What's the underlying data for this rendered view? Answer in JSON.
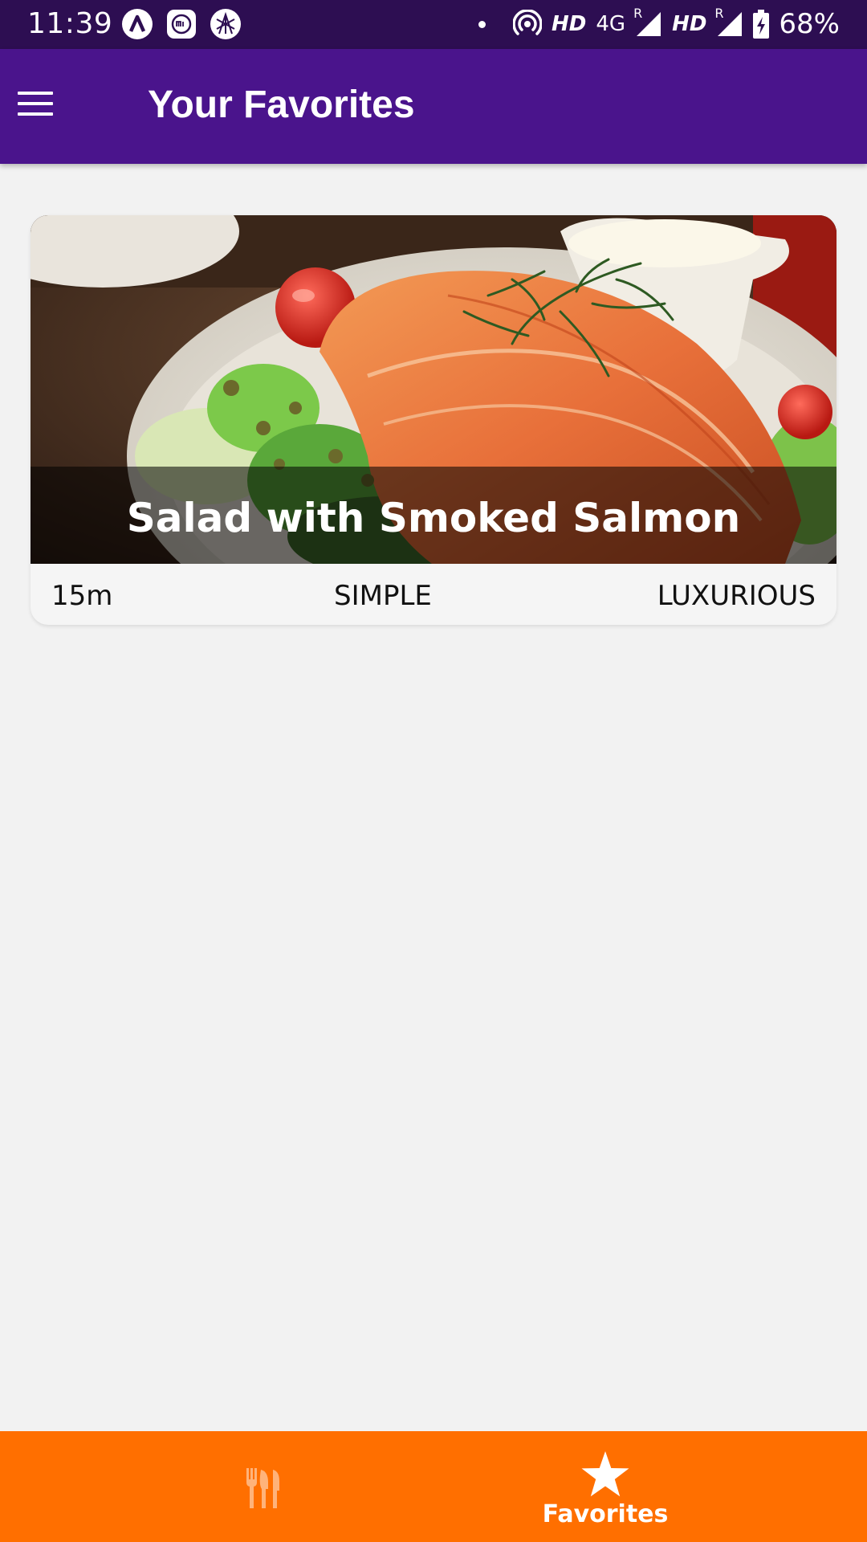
{
  "status_bar": {
    "time": "11:39",
    "network_1": "4G",
    "hd_1": "HD",
    "roaming_1": "R",
    "hd_2": "HD",
    "roaming_2": "R",
    "battery": "68%",
    "icons": [
      "notification-app-icon",
      "mi-app-icon",
      "spider-app-icon",
      "hotspot-icon",
      "signal-icon",
      "battery-charging-icon"
    ]
  },
  "app_bar": {
    "title": "Your Favorites",
    "menu_icon": "hamburger-menu-icon"
  },
  "meals": [
    {
      "title": "Salad with Smoked Salmon",
      "duration": "15m",
      "complexity": "SIMPLE",
      "affordability": "LUXURIOUS",
      "image": "smoked-salmon-salad-photo"
    }
  ],
  "tabs": [
    {
      "label": "Meals",
      "icon": "restaurant-icon",
      "active": false
    },
    {
      "label": "Favorites",
      "icon": "star-icon",
      "active": true
    }
  ],
  "colors": {
    "status_bar": "#2d0e52",
    "app_bar": "#4a148c",
    "tab_bar": "#ff6f00",
    "background": "#f2f2f2",
    "card": "#f5f5f5",
    "inactive_tab_icon": "#ffb37a"
  }
}
